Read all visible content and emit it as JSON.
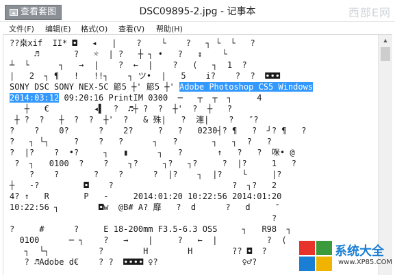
{
  "titlebar": {
    "view_button_label": "查看套图",
    "title": "DSC09895-2.jpg - 记事本",
    "watermark": "西部E网"
  },
  "menu": [
    {
      "label": "文件(F)"
    },
    {
      "label": "编辑(E)"
    },
    {
      "label": "格式(O)"
    },
    {
      "label": "查看(V)"
    },
    {
      "label": "帮助(H)"
    }
  ],
  "editor": {
    "lines": [
      "??桒xif  II* ◘   ◂   |    ?    └    ?   ┐ └  └   ?",
      "     ♬       ?   ☼  | ?   ┼ ┐ •   ?   ↕    └",
      "┴  └      ┐   →  |    ?  ←  |    ?   (   ┐  1  ?",
      "|   2  ┐ ¶   !   !!┐    ┐ ツ•  |   5    i?    ?  ?  ◘◘◘",
      "SONY DSC SONY NEX-5C 簓5 ┼' 簓5 ┼'",
      "",
      "   ┼   €         ◂▌  ?  ♬┼ ?  ?  ┼'  ?  ┼   ?",
      " ┼ ?  ?   ┼  ?  ?  ┼'  ?   & 殊|   ?  瀗|    ?   ″?",
      "?    ?    0?      ?    2?     ?   ?   0230┤? ¶   ?  ┘? ¶   ?",
      "?   ┐ └┐     ?    ?   ?      ┐   ?       ┐   ┐  ?   ?",
      "?  |?    ?  •?     ┐   ▮      ┐   ?       ↑   ?   ?  咪• @",
      " ?  ┐   0100  ?    ?    ┐?     ┐?   ┐?     ?  |?     1   ?",
      "    ?    ?       ?    ?      ?  |?    ┐  |?    └     |?",
      "┼   -?         ◘    ?                        ?  ┐?   2",
      "4? ↑   R       P   -     2014:01:20 10:22:56 2014:01:20",
      "10:22:56 ┐        ◘w  @B# A? 靡   ?  d      ?   d     ″",
      "                                                     ?",
      "?     #      ?     E 18-200mm F3.5-6.3 OSS     ┐   R98  ┐",
      "  0100      ─ ┐    ?   →    |     ?   ←  |          ?  (",
      "   ┐  └┐          ?        H        H        ?? ◘  ?",
      "   ? ♬Adobe d€    ? ?  ◘◘◘◘ ♀?                 ♀♂?"
    ],
    "selected_text_1": "Adobe Photoshop CS5 Windows",
    "selected_text_2": "2014:03:12",
    "line6_tail": " 09:20:16 PrintIM 0300  ─   ┬  ┬  ┐     4"
  },
  "logo": {
    "text": "系统大全",
    "url": "www.XP85.COM",
    "colors": [
      "#e8332a",
      "#3a9a3c",
      "#1a7fd4",
      "#f0b400"
    ]
  }
}
